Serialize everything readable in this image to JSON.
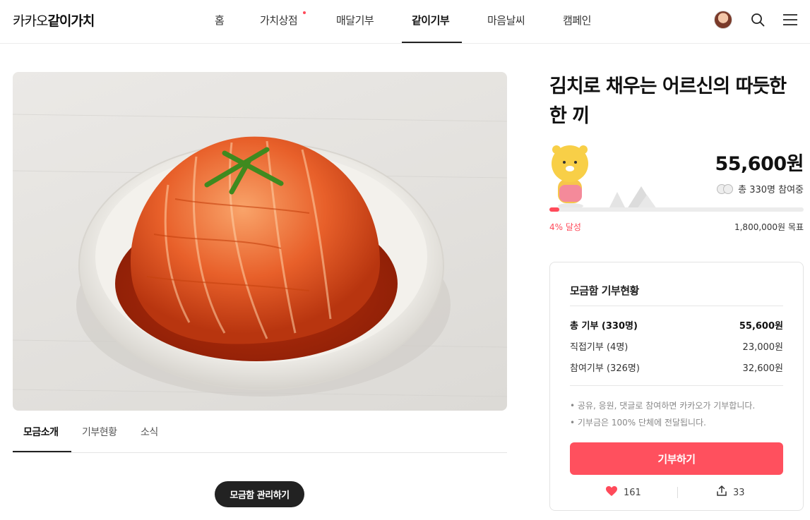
{
  "header": {
    "logo_prefix": "카카오",
    "logo_bold": "같이가치",
    "nav": [
      "홈",
      "가치상점",
      "매달기부",
      "같이기부",
      "마음날씨",
      "캠페인"
    ],
    "active_nav": "같이기부",
    "icons": [
      "avatar",
      "search-icon",
      "menu-icon"
    ]
  },
  "hero": {
    "image": "kimchi-bowl-photo"
  },
  "tabs": [
    "모금소개",
    "기부현황",
    "소식"
  ],
  "active_tab": "모금소개",
  "manage_button": "모금함 관리하기",
  "campaign": {
    "title": "김치로 채우는 어르신의 따듯한 한 끼",
    "amount": "55,600원",
    "participants": "총 330명 참여중",
    "progress": 0.04,
    "achieved": "4% 달성",
    "goal": "1,800,000원 목표"
  },
  "card": {
    "title": "모금함 기부현황",
    "rows": [
      {
        "label": "총 기부 (330명)",
        "value": "55,600원"
      },
      {
        "label": "직접기부 (4명)",
        "value": "23,000원"
      },
      {
        "label": "참여기부 (326명)",
        "value": "32,600원"
      }
    ],
    "notes": [
      "• 공유, 응원, 댓글로 참여하면 카카오가 기부합니다.",
      "• 기부금은 100% 단체에 전달됩니다."
    ],
    "donate_button": "기부하기",
    "likes": "161",
    "shares": "33"
  },
  "colors": {
    "accent": "#ff505e",
    "dark": "#222222"
  }
}
